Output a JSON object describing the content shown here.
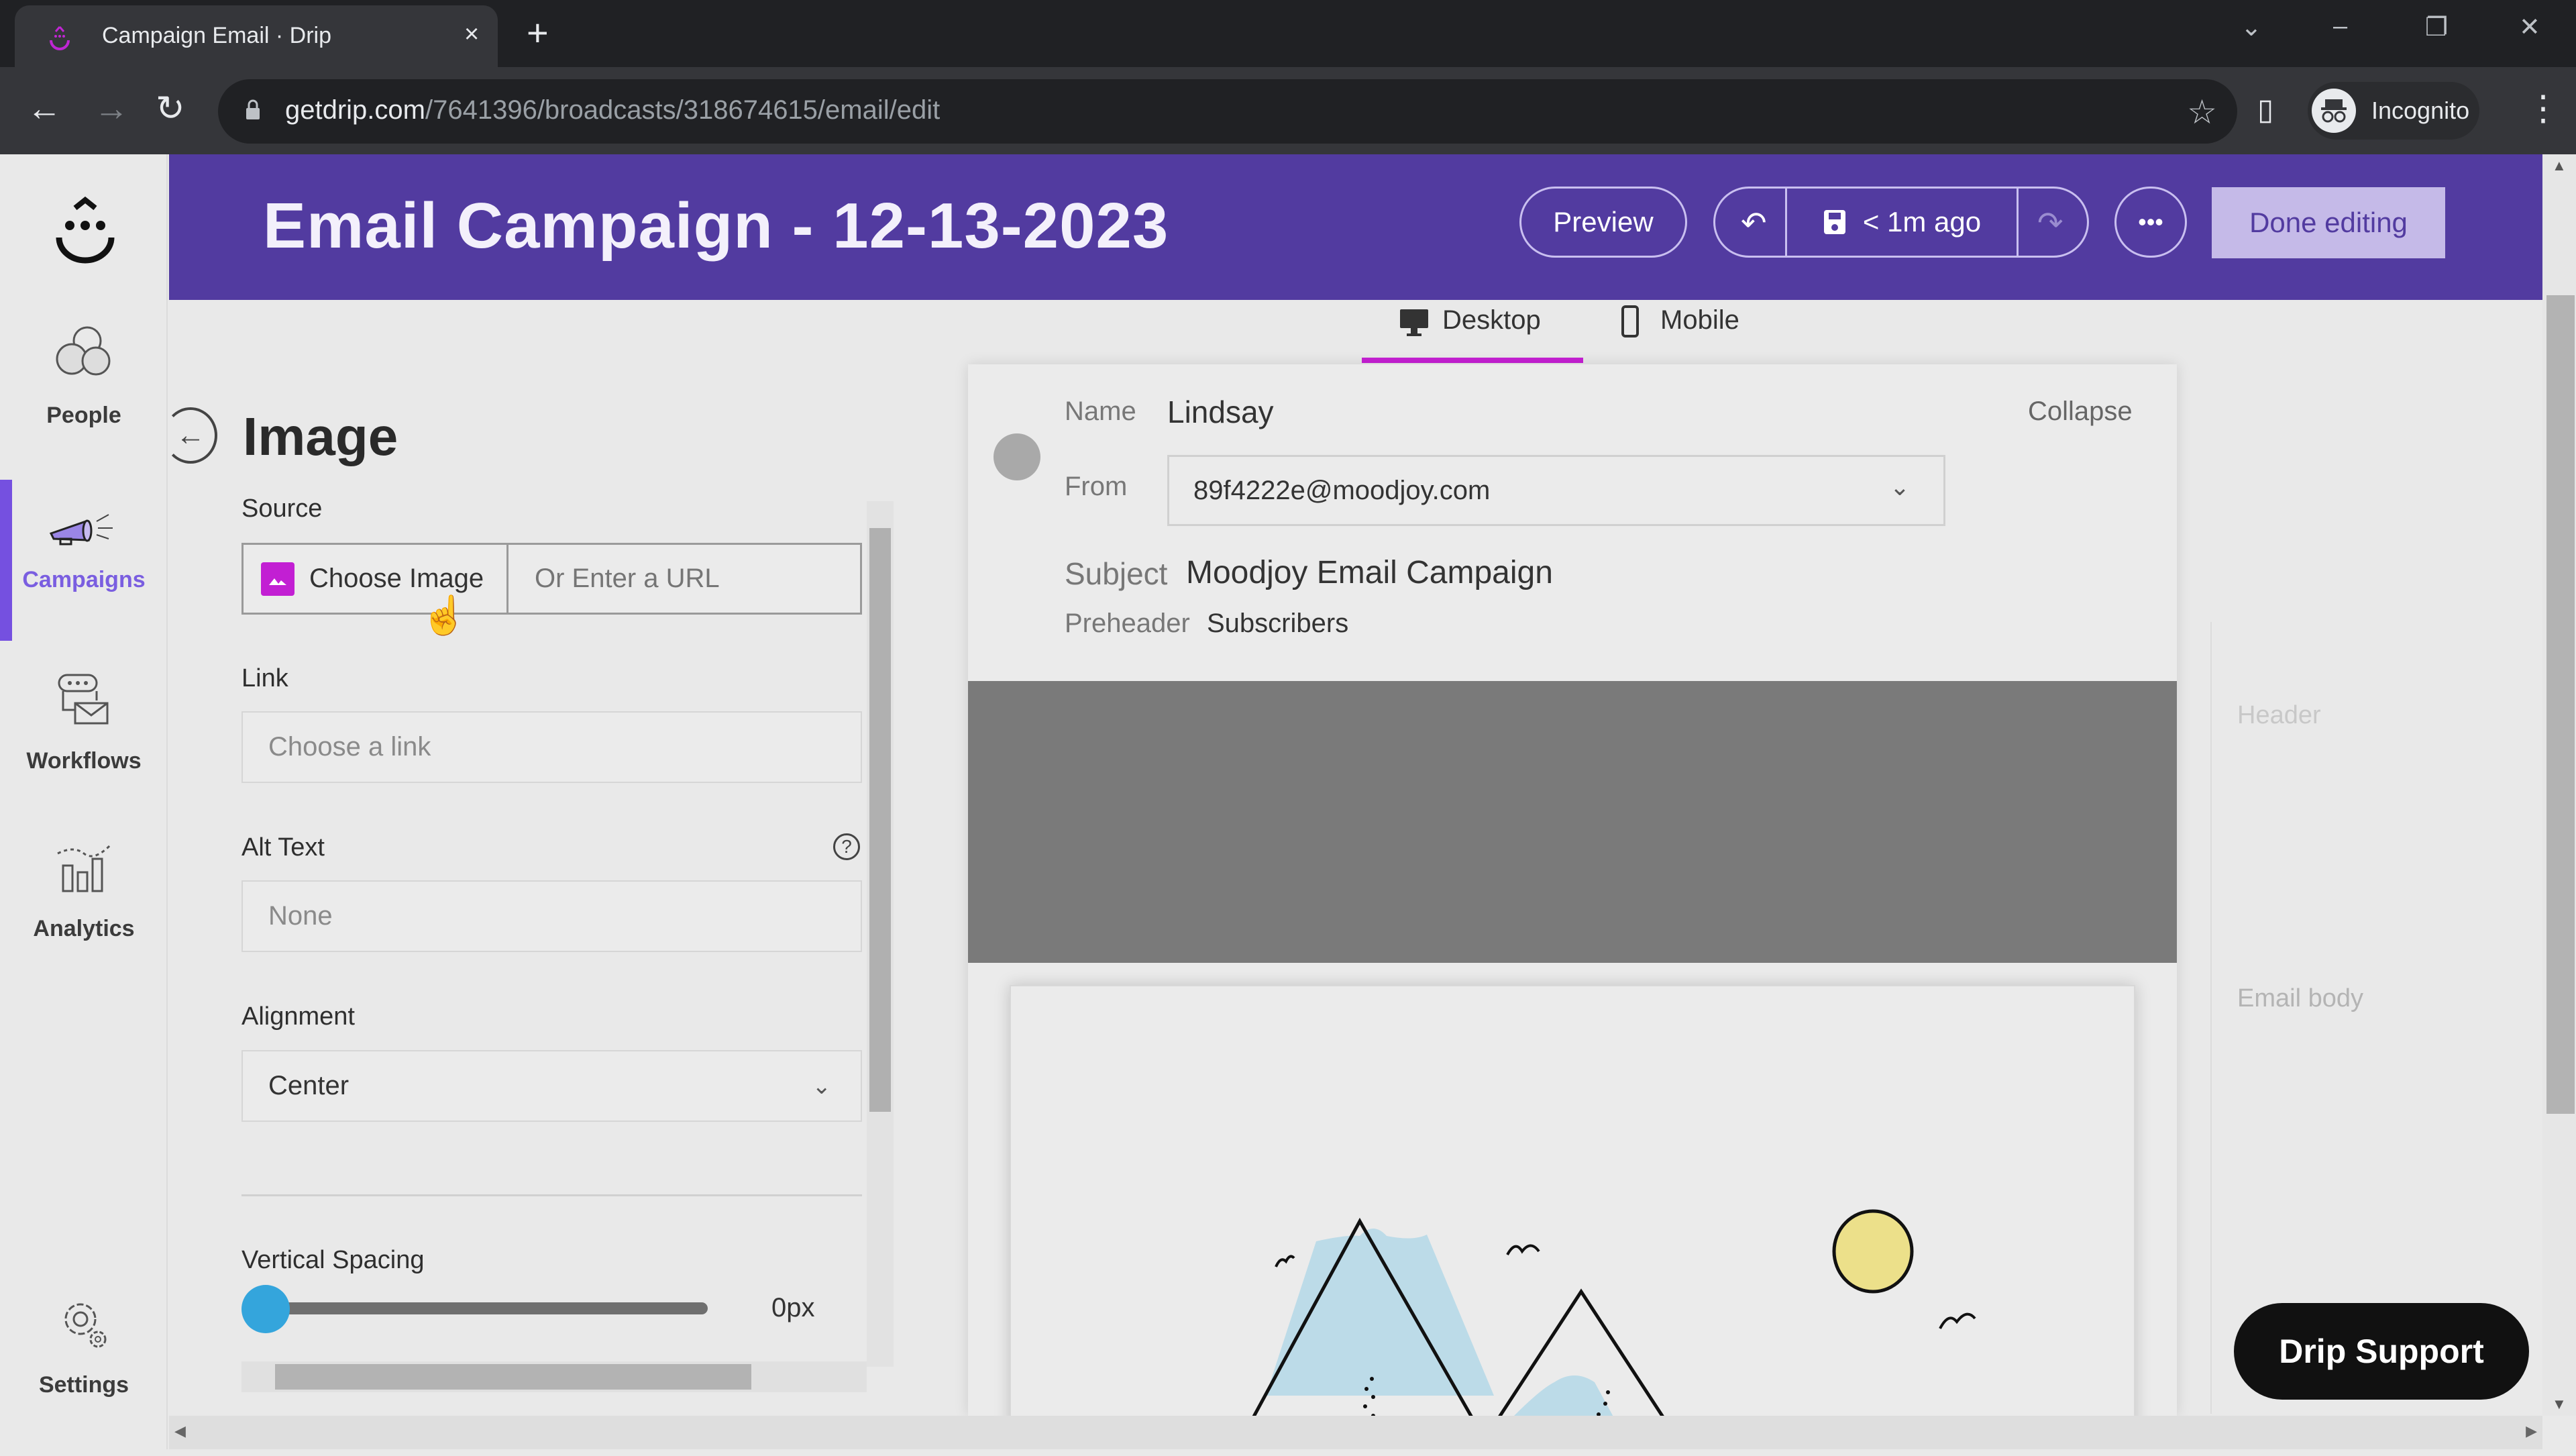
{
  "browser": {
    "tab_title": "Campaign Email · Drip",
    "url_domain": "getdrip.com",
    "url_path": "/7641396/broadcasts/318674615/email/edit",
    "profile_label": "Incognito"
  },
  "sidebar": {
    "items": [
      {
        "label": "People",
        "icon": "people-icon"
      },
      {
        "label": "Campaigns",
        "icon": "megaphone-icon",
        "active": true
      },
      {
        "label": "Workflows",
        "icon": "workflow-icon"
      },
      {
        "label": "Analytics",
        "icon": "analytics-icon"
      },
      {
        "label": "Settings",
        "icon": "gear-icon"
      }
    ]
  },
  "header": {
    "title": "Email Campaign - 12-13-2023",
    "preview_label": "Preview",
    "save_status": "< 1m ago",
    "done_label": "Done editing",
    "brand_color": "#523ba0"
  },
  "panel": {
    "title": "Image",
    "source_label": "Source",
    "choose_image_label": "Choose Image",
    "url_placeholder": "Or Enter a URL",
    "link_label": "Link",
    "link_placeholder": "Choose a link",
    "alt_label": "Alt Text",
    "alt_placeholder": "None",
    "alignment_label": "Alignment",
    "alignment_value": "Center",
    "spacing_label": "Vertical Spacing",
    "spacing_value": "0px",
    "spacing_fraction": 0
  },
  "device_tabs": [
    {
      "label": "Desktop",
      "active": true
    },
    {
      "label": "Mobile",
      "active": false
    }
  ],
  "email": {
    "name_label": "Name",
    "name_value": "Lindsay",
    "collapse_label": "Collapse",
    "from_label": "From",
    "from_value": "89f4222e@moodjoy.com",
    "subject_label": "Subject",
    "subject_value": "Moodjoy Email Campaign",
    "preheader_label": "Preheader",
    "preheader_value": "Subscribers"
  },
  "outline": {
    "header_label": "Header",
    "body_label": "Email body"
  },
  "support_label": "Drip Support"
}
